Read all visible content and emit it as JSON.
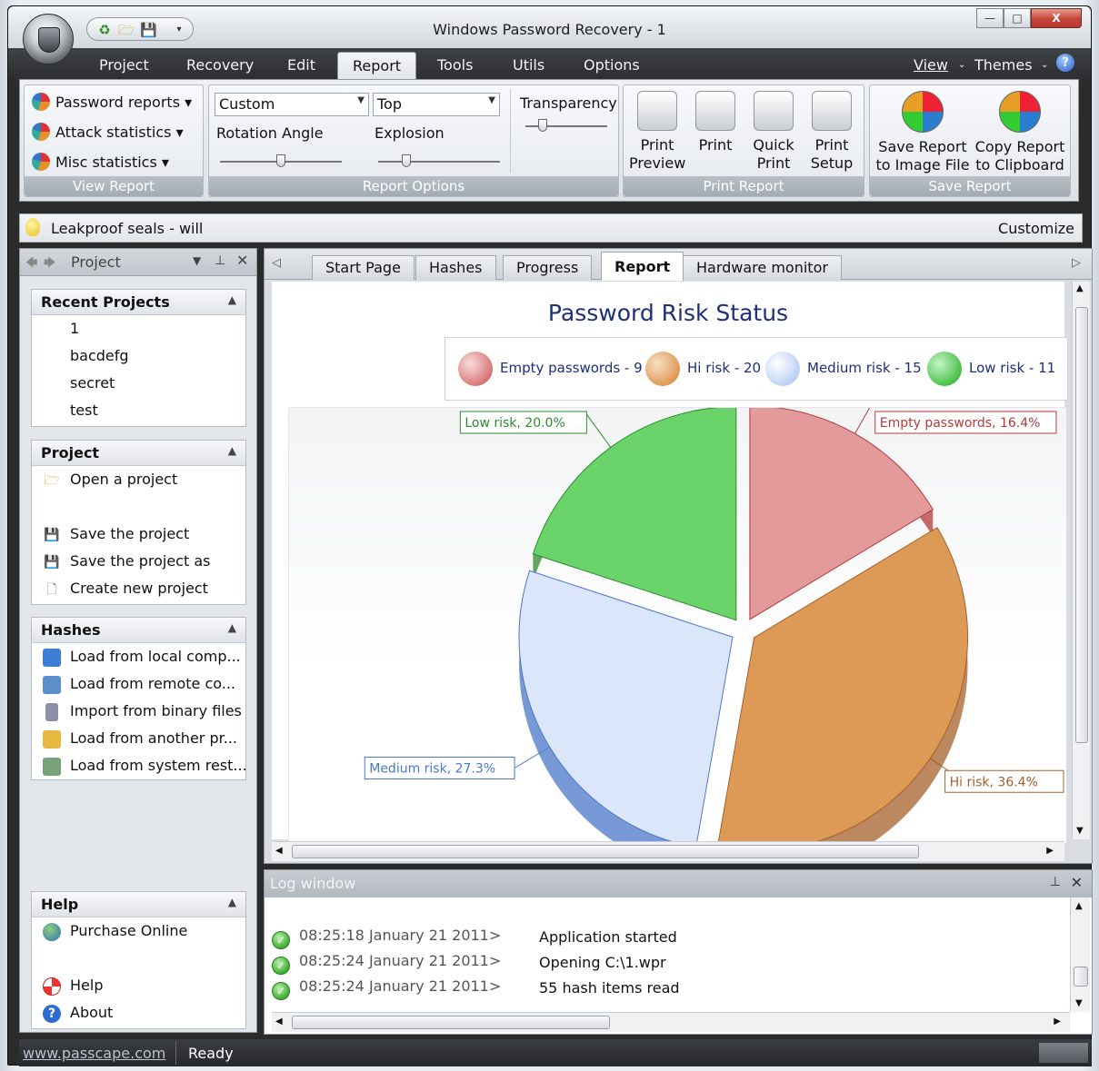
{
  "window": {
    "title": "Windows Password Recovery - 1"
  },
  "menu": {
    "tabs": [
      "Project",
      "Recovery",
      "Edit",
      "Report",
      "Tools",
      "Utils",
      "Options"
    ],
    "active": "Report",
    "right": {
      "view": "View",
      "themes": "Themes"
    }
  },
  "ribbon": {
    "view_report": {
      "label": "View Report",
      "items": [
        "Password reports",
        "Attack statistics",
        "Misc statistics"
      ]
    },
    "report_options": {
      "label": "Report Options",
      "chart_style": "Custom",
      "legend_position": "Top",
      "rotation_label": "Rotation Angle",
      "explosion_label": "Explosion",
      "transparency_label": "Transparency"
    },
    "print_report": {
      "label": "Print Report",
      "buttons": [
        {
          "line1": "Print",
          "line2": "Preview"
        },
        {
          "line1": "Print",
          "line2": ""
        },
        {
          "line1": "Quick",
          "line2": "Print"
        },
        {
          "line1": "Print",
          "line2": "Setup"
        }
      ]
    },
    "save_report": {
      "label": "Save Report",
      "buttons": [
        {
          "line1": "Save Report",
          "line2": "to Image File"
        },
        {
          "line1": "Copy Report",
          "line2": "to Clipboard"
        }
      ]
    }
  },
  "tipbar": {
    "tip": "Leakproof seals - will",
    "customize": "Customize"
  },
  "left_panel": {
    "title": "Project",
    "recent": {
      "header": "Recent Projects",
      "items": [
        "1",
        "bacdefg",
        "secret",
        "test"
      ]
    },
    "project": {
      "header": "Project",
      "items": [
        "Open a project",
        "Save the project",
        "Save the project as",
        "Create new project"
      ]
    },
    "hashes": {
      "header": "Hashes",
      "items": [
        "Load from local comp...",
        "Load from remote co...",
        "Import from binary files",
        "Load from another pr...",
        "Load from system rest..."
      ]
    },
    "help": {
      "header": "Help",
      "items": [
        "Purchase Online",
        "Help",
        "About"
      ]
    }
  },
  "doc_tabs": {
    "items": [
      "Start Page",
      "Hashes",
      "Progress",
      "Report",
      "Hardware monitor"
    ],
    "active": "Report"
  },
  "chart_data": {
    "type": "pie",
    "title": "Password Risk Status",
    "legend_position": "top",
    "legend": [
      {
        "label": "Empty passwords - 9",
        "color": "#e07a7a"
      },
      {
        "label": "Hi risk - 20",
        "color": "#e0964a"
      },
      {
        "label": "Medium risk - 15",
        "color": "#b9cff5"
      },
      {
        "label": "Low risk - 11",
        "color": "#4fc04f"
      }
    ],
    "slices": [
      {
        "name": "Empty passwords",
        "count": 9,
        "percent": 16.4,
        "label": "Empty passwords, 16.4%",
        "color": "#e39a9a",
        "border": "#b43a3a"
      },
      {
        "name": "Hi risk",
        "count": 20,
        "percent": 36.4,
        "label": "Hi risk, 36.4%",
        "color": "#dc9a56",
        "border": "#a6602a"
      },
      {
        "name": "Medium risk",
        "count": 15,
        "percent": 27.3,
        "label": "Medium risk, 27.3%",
        "color": "#dbe6fb",
        "border": "#4a78c9"
      },
      {
        "name": "Low risk",
        "count": 11,
        "percent": 20.0,
        "label": "Low risk, 20.0%",
        "color": "#6ad36a",
        "border": "#2f8a2f"
      }
    ]
  },
  "log": {
    "title": "Log window",
    "rows": [
      {
        "time": "08:25:18 January 21 2011>",
        "message": "Application started"
      },
      {
        "time": "08:25:24 January 21 2011>",
        "message": "Opening C:\\1.wpr"
      },
      {
        "time": "08:25:24 January 21 2011>",
        "message": "55 hash items read"
      }
    ]
  },
  "status": {
    "link": "www.passcape.com",
    "text": "Ready"
  }
}
